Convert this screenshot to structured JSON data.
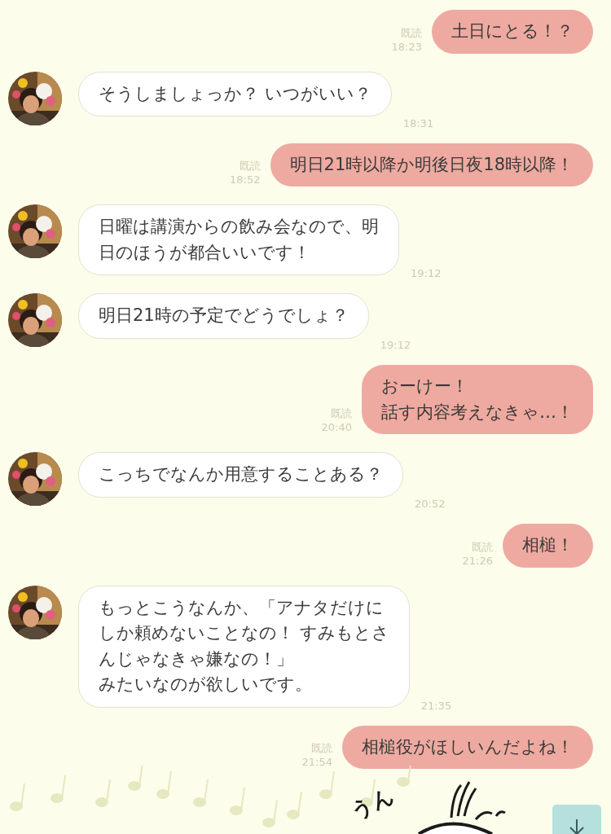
{
  "messages": [
    {
      "kind": "sent",
      "lines": [
        "土日にとる！？"
      ],
      "read": "既読",
      "time": "18:23"
    },
    {
      "kind": "received",
      "avatar": {
        "kind": "picture"
      },
      "lines": [
        "そうしましょっか？ いつがいい？"
      ],
      "time": "18:31"
    },
    {
      "kind": "sent",
      "lines": [
        "明日21時以降か明後日夜18時以降！"
      ],
      "read": "既読",
      "time": "18:52"
    },
    {
      "kind": "received",
      "avatar": {
        "kind": "picture"
      },
      "lines": [
        "日曜は講演からの飲み会なので、明",
        "日のほうが都合いいです！"
      ],
      "time": "19:12"
    },
    {
      "kind": "received",
      "avatar": {
        "kind": "picture"
      },
      "lines": [
        "明日21時の予定でどうでしょ？"
      ],
      "time": "19:12"
    },
    {
      "kind": "sent",
      "lines": [
        "おーけー！",
        "話す内容考えなきゃ…！"
      ],
      "read": "既読",
      "time": "20:40"
    },
    {
      "kind": "received",
      "avatar": {
        "kind": "picture"
      },
      "lines": [
        "こっちでなんか用意することある？"
      ],
      "time": "20:52"
    },
    {
      "kind": "sent",
      "lines": [
        "相槌！"
      ],
      "read": "既読",
      "time": "21:26"
    },
    {
      "kind": "received",
      "avatar": {
        "kind": "picture"
      },
      "lines": [
        "もっとこうなんか、「アナタだけに",
        "しか頼めないことなの！ すみもとさ",
        "んじゃなきゃ嫌なの！」",
        "みたいなのが欲しいです。"
      ],
      "time": "21:35"
    },
    {
      "kind": "sent",
      "lines": [
        "相槌役がほしいんだよね！"
      ],
      "read": "既読",
      "time": "21:54"
    }
  ],
  "sticker": {
    "text": "うん"
  }
}
